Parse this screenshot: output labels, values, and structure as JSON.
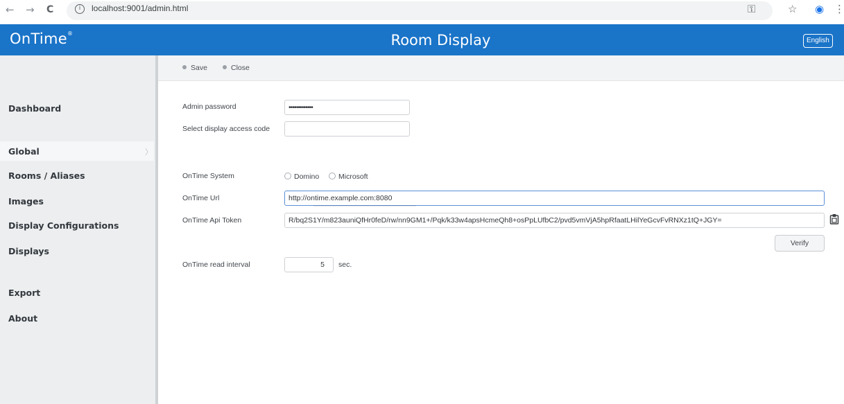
{
  "browser": {
    "url": "localhost:9001/admin.html",
    "back_icon": "←",
    "forward_icon": "→",
    "reload_icon": "C",
    "info_icon": "i",
    "key_icon": "⚿",
    "star_icon": "☆",
    "profile_icon": "◉",
    "menu_icon": "⋮"
  },
  "header": {
    "logo": "OnTime",
    "logo_mark": "®",
    "title": "Room Display",
    "language": "English",
    "bar_color": "#1a74c8"
  },
  "sidebar": {
    "items": [
      {
        "label": "Dashboard"
      },
      {
        "label": "Global"
      },
      {
        "label": "Rooms / Aliases"
      },
      {
        "label": "Images"
      },
      {
        "label": "Display Configurations"
      },
      {
        "label": "Displays"
      },
      {
        "label": "Export"
      },
      {
        "label": "About"
      }
    ],
    "chevron": "〉"
  },
  "toolbar": {
    "save_label": "Save",
    "close_label": "Close"
  },
  "form": {
    "admin_password_label": "Admin password",
    "admin_password_value": "•••••••••••••",
    "access_code_label": "Select display access code",
    "access_code_value": "",
    "system_label": "OnTime System",
    "system_options": [
      "Domino",
      "Microsoft"
    ],
    "url_label": "OnTime Url",
    "url_value": "http://ontime.example.com:8080",
    "token_label": "OnTime Api Token",
    "token_value": "R/bq2S1Y/m823auniQfHr0feD/rw/nn9GM1+/Pqk/k33w4apsHcmeQh8+osPpLUfbC2/pvd5vmVjA5hpRfaatLHilYeGcvFvRNXz1tQ+JGY=",
    "verify_label": "Verify",
    "interval_label": "OnTime read interval",
    "interval_value": "5",
    "interval_unit": "sec."
  }
}
